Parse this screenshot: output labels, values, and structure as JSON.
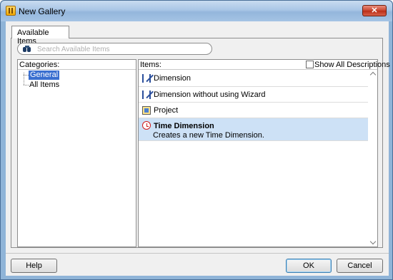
{
  "window": {
    "title": "New Gallery",
    "close_label": "✕"
  },
  "tabs": [
    {
      "label": "Available Items"
    }
  ],
  "search": {
    "placeholder": "Search Available Items",
    "value": ""
  },
  "categories": {
    "header": "Categories:",
    "items": [
      {
        "label": "General",
        "selected": true
      },
      {
        "label": "All Items",
        "selected": false
      }
    ]
  },
  "items": {
    "header": "Items:",
    "show_all_descriptions": {
      "label": "Show All Descriptions",
      "checked": false
    },
    "list": [
      {
        "label": "Dimension",
        "icon": "dimension-icon",
        "selected": false
      },
      {
        "label": "Dimension without using Wizard",
        "icon": "dimension-icon",
        "selected": false
      },
      {
        "label": "Project",
        "icon": "project-icon",
        "selected": false
      },
      {
        "label": "Time Dimension",
        "description": "Creates a new Time Dimension.",
        "icon": "time-dimension-icon",
        "selected": true
      }
    ]
  },
  "buttons": {
    "help": "Help",
    "ok": "OK",
    "cancel": "Cancel"
  },
  "colors": {
    "selection": "#3a6fd0",
    "selected_row": "#cde1f6",
    "close_button": "#c7432d"
  }
}
